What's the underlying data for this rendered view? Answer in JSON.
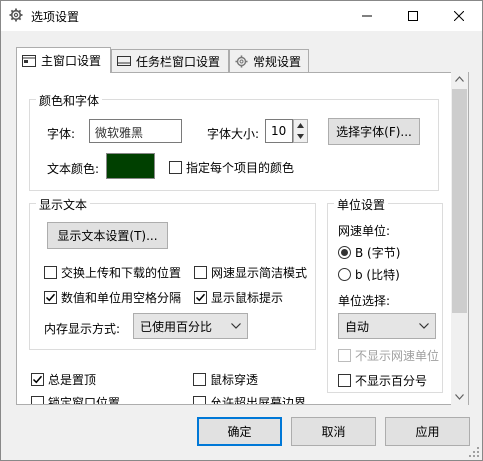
{
  "window": {
    "title": "选项设置",
    "minimize_glyph": "—",
    "maximize_glyph": "☐",
    "close_glyph": "✕"
  },
  "tabs": [
    {
      "label": "主窗口设置",
      "icon": "window-icon",
      "active": true
    },
    {
      "label": "任务栏窗口设置",
      "icon": "taskbar-icon",
      "active": false
    },
    {
      "label": "常规设置",
      "icon": "gear-icon",
      "active": false
    }
  ],
  "color_font": {
    "group_title": "颜色和字体",
    "font_label": "字体:",
    "font_value": "微软雅黑",
    "font_size_label": "字体大小:",
    "font_size_value": "10",
    "choose_font_button": "选择字体(F)...",
    "text_color_label": "文本颜色:",
    "text_color": "#004000",
    "per_item_color_label": "指定每个项目的颜色",
    "per_item_color_checked": false
  },
  "display_text": {
    "group_title": "显示文本",
    "settings_button": "显示文本设置(T)...",
    "swap_updown": {
      "label": "交换上传和下载的位置",
      "checked": false
    },
    "concise_speed": {
      "label": "网速显示简洁模式",
      "checked": false
    },
    "space_separate": {
      "label": "数值和单位用空格分隔",
      "checked": true
    },
    "mouse_tip": {
      "label": "显示鼠标提示",
      "checked": true
    },
    "memory_mode_label": "内存显示方式:",
    "memory_mode_value": "已使用百分比"
  },
  "unit_settings": {
    "group_title": "单位设置",
    "speed_unit_label": "网速单位:",
    "unit_byte": {
      "label": "B (字节)",
      "selected": true
    },
    "unit_bit": {
      "label": "b (比特)",
      "selected": false
    },
    "unit_select_label": "单位选择:",
    "unit_select_value": "自动",
    "hide_speed_unit": {
      "label": "不显示网速单位",
      "checked": false,
      "disabled": true
    },
    "hide_percent": {
      "label": "不显示百分号",
      "checked": false
    }
  },
  "misc": {
    "always_on_top": {
      "label": "总是置顶",
      "checked": true
    },
    "mouse_through": {
      "label": "鼠标穿透",
      "checked": false
    },
    "lock_position": {
      "label": "锁定窗口位置",
      "checked": false
    },
    "allow_offscreen": {
      "label": "允许超出屏幕边界",
      "checked": false
    }
  },
  "footer": {
    "ok": "确定",
    "cancel": "取消",
    "apply": "应用"
  },
  "colors": {
    "accent": "#0078d7",
    "swatch": "#004000"
  }
}
